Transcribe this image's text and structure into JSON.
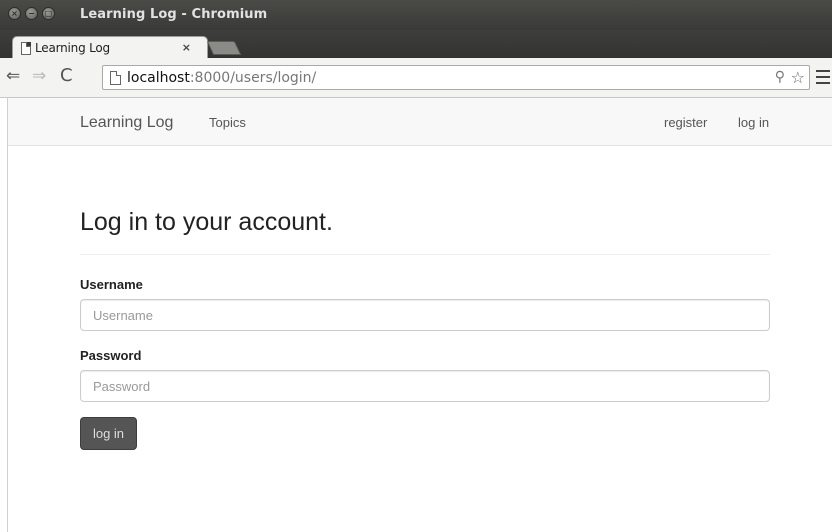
{
  "window": {
    "title": "Learning Log - Chromium",
    "buttons": {
      "close": "×",
      "minimize": "−",
      "maximize": "□"
    }
  },
  "tab": {
    "label": "Learning Log",
    "close_glyph": "×"
  },
  "toolbar": {
    "back_glyph": "⇐",
    "forward_glyph": "⇒",
    "reload_glyph": "C",
    "url_host": "localhost",
    "url_rest": ":8000/users/login/",
    "key_glyph": "⚲",
    "star_glyph": "☆"
  },
  "navbar": {
    "brand": "Learning Log",
    "topics": "Topics",
    "register": "register",
    "login": "log in"
  },
  "form": {
    "heading": "Log in to your account.",
    "username_label": "Username",
    "username_placeholder": "Username",
    "username_value": "",
    "password_label": "Password",
    "password_placeholder": "Password",
    "password_value": "",
    "submit_label": "log in"
  },
  "colors": {
    "titlebar": "#3a3a38",
    "button": "#555555",
    "navbar": "#f8f8f8"
  }
}
